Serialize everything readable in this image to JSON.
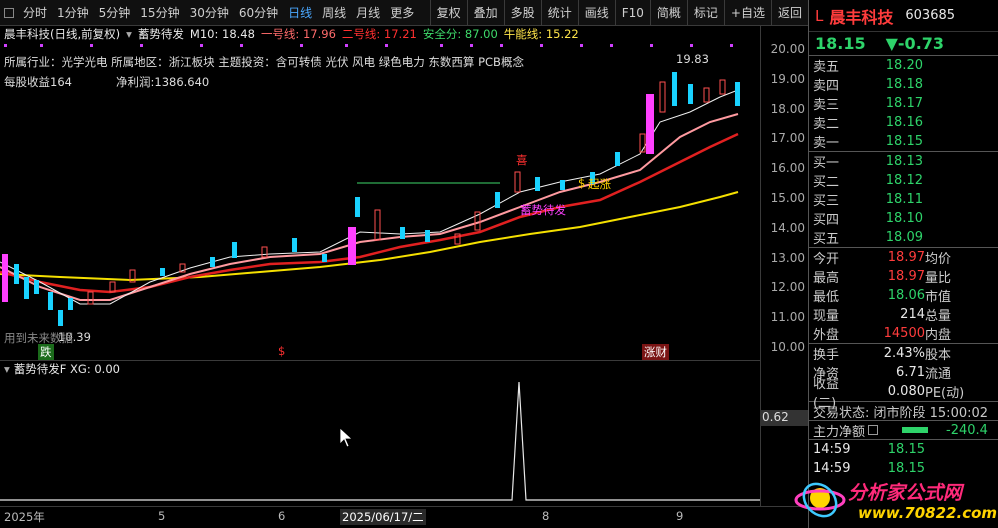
{
  "toolbar": {
    "periods": [
      "分时",
      "1分钟",
      "5分钟",
      "15分钟",
      "30分钟",
      "60分钟",
      "日线",
      "周线",
      "月线",
      "更多"
    ],
    "active_period": "日线",
    "actions": [
      "复权",
      "叠加",
      "多股",
      "统计",
      "画线",
      "F10",
      "简概",
      "标记",
      "+自选",
      "返回"
    ]
  },
  "indicator": {
    "stock_label": "晨丰科技(日线,前复权)",
    "formula": "蓄势待发",
    "m10": "M10: 18.48",
    "line1": "一号线: 17.96",
    "line2": "二号线: 17.21",
    "safety": "安全分: 87.00",
    "bull": "牛能线: 15.22"
  },
  "info": {
    "industry_line": "所属行业：光学光电  所属地区：浙江板块  主题投资：含可转债 光伏 风电 绿色电力 东数西算 PCB概念",
    "eps": "每股收益164",
    "profit": "净利润:1386.640"
  },
  "chart_annotations": {
    "high_label": "19.83",
    "low_label": "10.39",
    "note_bottom": "用到未来数据",
    "tag_buy": "蓄势待发",
    "tag_xi": "喜",
    "tag_money": "$",
    "tag_money2": "起涨",
    "bottom_tags": [
      "跌",
      "$",
      "涨财"
    ]
  },
  "price_axis": [
    "20.00",
    "19.00",
    "18.00",
    "17.00",
    "16.00",
    "15.00",
    "14.00",
    "13.00",
    "12.00",
    "11.00",
    "10.00"
  ],
  "sub_panel": {
    "title": "蓄势待发F  XG: 0.00",
    "axis_value": "0.62"
  },
  "time_axis": [
    "2025年",
    "5",
    "6",
    "2025/06/17/二",
    "8",
    "9"
  ],
  "quote": {
    "market_tag": "L",
    "name": "晨丰科技",
    "code": "603685",
    "price": "18.15",
    "change": "▼-0.73",
    "sell": [
      {
        "label": "卖五",
        "price": "18.20",
        "vol": ""
      },
      {
        "label": "卖四",
        "price": "18.18",
        "vol": ""
      },
      {
        "label": "卖三",
        "price": "18.17",
        "vol": ""
      },
      {
        "label": "卖二",
        "price": "18.16",
        "vol": ""
      },
      {
        "label": "卖一",
        "price": "18.15",
        "vol": ""
      }
    ],
    "buy": [
      {
        "label": "买一",
        "price": "18.13"
      },
      {
        "label": "买二",
        "price": "18.12"
      },
      {
        "label": "买三",
        "price": "18.11"
      },
      {
        "label": "买四",
        "price": "18.10"
      },
      {
        "label": "买五",
        "price": "18.09"
      }
    ],
    "stats": [
      {
        "l1": "今开",
        "v1": "18.97",
        "l2": "均价"
      },
      {
        "l1": "最高",
        "v1": "18.97",
        "l2": "量比"
      },
      {
        "l1": "最低",
        "v1": "18.06",
        "l2": "市值"
      },
      {
        "l1": "现量",
        "v1": "214",
        "l2": "总量"
      },
      {
        "l1": "外盘",
        "v1": "14500",
        "l2": "内盘"
      }
    ],
    "stats2": [
      {
        "l1": "换手",
        "v1": "2.43%",
        "l2": "股本"
      },
      {
        "l1": "净资",
        "v1": "6.71",
        "l2": "流通"
      },
      {
        "l1": "收益(二)",
        "v1": "0.080",
        "l2": "PE(动)"
      }
    ],
    "trade_status": "交易状态: 闭市阶段 15:00:02",
    "main_flow_label": "主力净额",
    "main_flow_value": "-240.4",
    "ticks": [
      {
        "time": "14:59",
        "price": "18.15"
      },
      {
        "time": "14:59",
        "price": "18.15"
      }
    ]
  },
  "watermark": {
    "text": "分析家公式网",
    "url": "www.70822.com"
  }
}
